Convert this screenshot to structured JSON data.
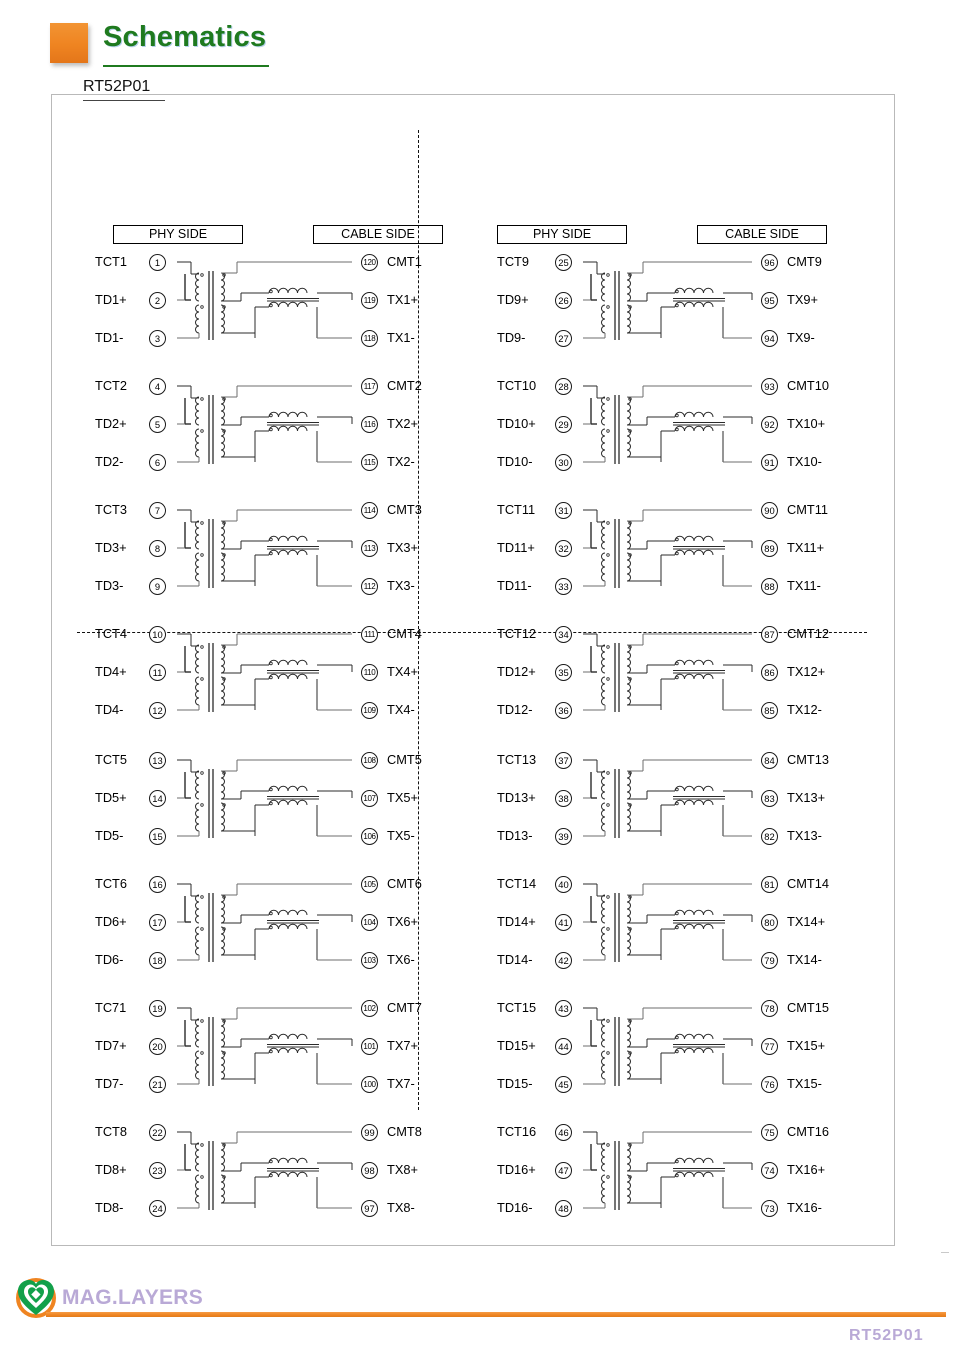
{
  "header": {
    "title": "Schematics",
    "part_number": "RT52P01",
    "accent_orange": "#ef8421",
    "accent_green": "#1f7a1f"
  },
  "column_headers": {
    "phy": "PHY SIDE",
    "cable": "CABLE SIDE"
  },
  "footer": {
    "brand": "MAG.LAYERS",
    "part_number": "RT52P01",
    "brand_color": "#b9a9d6",
    "logo_ring_color": "#ef8421",
    "logo_mark_color": "#12a04a"
  },
  "quadrants": [
    {
      "id": "top-left",
      "groups": [
        {
          "phy": [
            {
              "label": "TCT1",
              "pin": "1"
            },
            {
              "label": "TD1+",
              "pin": "2"
            },
            {
              "label": "TD1-",
              "pin": "3"
            }
          ],
          "cable": [
            {
              "pin": "120",
              "label": "CMT1"
            },
            {
              "pin": "119",
              "label": "TX1+"
            },
            {
              "pin": "118",
              "label": "TX1-"
            }
          ]
        },
        {
          "phy": [
            {
              "label": "TCT2",
              "pin": "4"
            },
            {
              "label": "TD2+",
              "pin": "5"
            },
            {
              "label": "TD2-",
              "pin": "6"
            }
          ],
          "cable": [
            {
              "pin": "117",
              "label": "CMT2"
            },
            {
              "pin": "116",
              "label": "TX2+"
            },
            {
              "pin": "115",
              "label": "TX2-"
            }
          ]
        },
        {
          "phy": [
            {
              "label": "TCT3",
              "pin": "7"
            },
            {
              "label": "TD3+",
              "pin": "8"
            },
            {
              "label": "TD3-",
              "pin": "9"
            }
          ],
          "cable": [
            {
              "pin": "114",
              "label": "CMT3"
            },
            {
              "pin": "113",
              "label": "TX3+"
            },
            {
              "pin": "112",
              "label": "TX3-"
            }
          ]
        },
        {
          "phy": [
            {
              "label": "TCT4",
              "pin": "10"
            },
            {
              "label": "TD4+",
              "pin": "11"
            },
            {
              "label": "TD4-",
              "pin": "12"
            }
          ],
          "cable": [
            {
              "pin": "111",
              "label": "CMT4"
            },
            {
              "pin": "110",
              "label": "TX4+"
            },
            {
              "pin": "109",
              "label": "TX4-"
            }
          ]
        }
      ]
    },
    {
      "id": "top-right",
      "groups": [
        {
          "phy": [
            {
              "label": "TCT9",
              "pin": "25"
            },
            {
              "label": "TD9+",
              "pin": "26"
            },
            {
              "label": "TD9-",
              "pin": "27"
            }
          ],
          "cable": [
            {
              "pin": "96",
              "label": "CMT9"
            },
            {
              "pin": "95",
              "label": "TX9+"
            },
            {
              "pin": "94",
              "label": "TX9-"
            }
          ]
        },
        {
          "phy": [
            {
              "label": "TCT10",
              "pin": "28"
            },
            {
              "label": "TD10+",
              "pin": "29"
            },
            {
              "label": "TD10-",
              "pin": "30"
            }
          ],
          "cable": [
            {
              "pin": "93",
              "label": "CMT10"
            },
            {
              "pin": "92",
              "label": "TX10+"
            },
            {
              "pin": "91",
              "label": "TX10-"
            }
          ]
        },
        {
          "phy": [
            {
              "label": "TCT11",
              "pin": "31"
            },
            {
              "label": "TD11+",
              "pin": "32"
            },
            {
              "label": "TD11-",
              "pin": "33"
            }
          ],
          "cable": [
            {
              "pin": "90",
              "label": "CMT11"
            },
            {
              "pin": "89",
              "label": "TX11+"
            },
            {
              "pin": "88",
              "label": "TX11-"
            }
          ]
        },
        {
          "phy": [
            {
              "label": "TCT12",
              "pin": "34"
            },
            {
              "label": "TD12+",
              "pin": "35"
            },
            {
              "label": "TD12-",
              "pin": "36"
            }
          ],
          "cable": [
            {
              "pin": "87",
              "label": "CMT12"
            },
            {
              "pin": "86",
              "label": "TX12+"
            },
            {
              "pin": "85",
              "label": "TX12-"
            }
          ]
        }
      ]
    },
    {
      "id": "bottom-left",
      "groups": [
        {
          "phy": [
            {
              "label": "TCT5",
              "pin": "13"
            },
            {
              "label": "TD5+",
              "pin": "14"
            },
            {
              "label": "TD5-",
              "pin": "15"
            }
          ],
          "cable": [
            {
              "pin": "108",
              "label": "CMT5"
            },
            {
              "pin": "107",
              "label": "TX5+"
            },
            {
              "pin": "106",
              "label": "TX5-"
            }
          ]
        },
        {
          "phy": [
            {
              "label": "TCT6",
              "pin": "16"
            },
            {
              "label": "TD6+",
              "pin": "17"
            },
            {
              "label": "TD6-",
              "pin": "18"
            }
          ],
          "cable": [
            {
              "pin": "105",
              "label": "CMT6"
            },
            {
              "pin": "104",
              "label": "TX6+"
            },
            {
              "pin": "103",
              "label": "TX6-"
            }
          ]
        },
        {
          "phy": [
            {
              "label": "TC71",
              "pin": "19"
            },
            {
              "label": "TD7+",
              "pin": "20"
            },
            {
              "label": "TD7-",
              "pin": "21"
            }
          ],
          "cable": [
            {
              "pin": "102",
              "label": "CMT7"
            },
            {
              "pin": "101",
              "label": "TX7+"
            },
            {
              "pin": "100",
              "label": "TX7-"
            }
          ]
        },
        {
          "phy": [
            {
              "label": "TCT8",
              "pin": "22"
            },
            {
              "label": "TD8+",
              "pin": "23"
            },
            {
              "label": "TD8-",
              "pin": "24"
            }
          ],
          "cable": [
            {
              "pin": "99",
              "label": "CMT8"
            },
            {
              "pin": "98",
              "label": "TX8+"
            },
            {
              "pin": "97",
              "label": "TX8-"
            }
          ]
        }
      ]
    },
    {
      "id": "bottom-right",
      "groups": [
        {
          "phy": [
            {
              "label": "TCT13",
              "pin": "37"
            },
            {
              "label": "TD13+",
              "pin": "38"
            },
            {
              "label": "TD13-",
              "pin": "39"
            }
          ],
          "cable": [
            {
              "pin": "84",
              "label": "CMT13"
            },
            {
              "pin": "83",
              "label": "TX13+"
            },
            {
              "pin": "82",
              "label": "TX13-"
            }
          ]
        },
        {
          "phy": [
            {
              "label": "TCT14",
              "pin": "40"
            },
            {
              "label": "TD14+",
              "pin": "41"
            },
            {
              "label": "TD14-",
              "pin": "42"
            }
          ],
          "cable": [
            {
              "pin": "81",
              "label": "CMT14"
            },
            {
              "pin": "80",
              "label": "TX14+"
            },
            {
              "pin": "79",
              "label": "TX14-"
            }
          ]
        },
        {
          "phy": [
            {
              "label": "TCT15",
              "pin": "43"
            },
            {
              "label": "TD15+",
              "pin": "44"
            },
            {
              "label": "TD15-",
              "pin": "45"
            }
          ],
          "cable": [
            {
              "pin": "78",
              "label": "CMT15"
            },
            {
              "pin": "77",
              "label": "TX15+"
            },
            {
              "pin": "76",
              "label": "TX15-"
            }
          ]
        },
        {
          "phy": [
            {
              "label": "TCT16",
              "pin": "46"
            },
            {
              "label": "TD16+",
              "pin": "47"
            },
            {
              "label": "TD16-",
              "pin": "48"
            }
          ],
          "cable": [
            {
              "pin": "75",
              "label": "CMT16"
            },
            {
              "pin": "74",
              "label": "TX16+"
            },
            {
              "pin": "73",
              "label": "TX16-"
            }
          ]
        }
      ]
    }
  ]
}
